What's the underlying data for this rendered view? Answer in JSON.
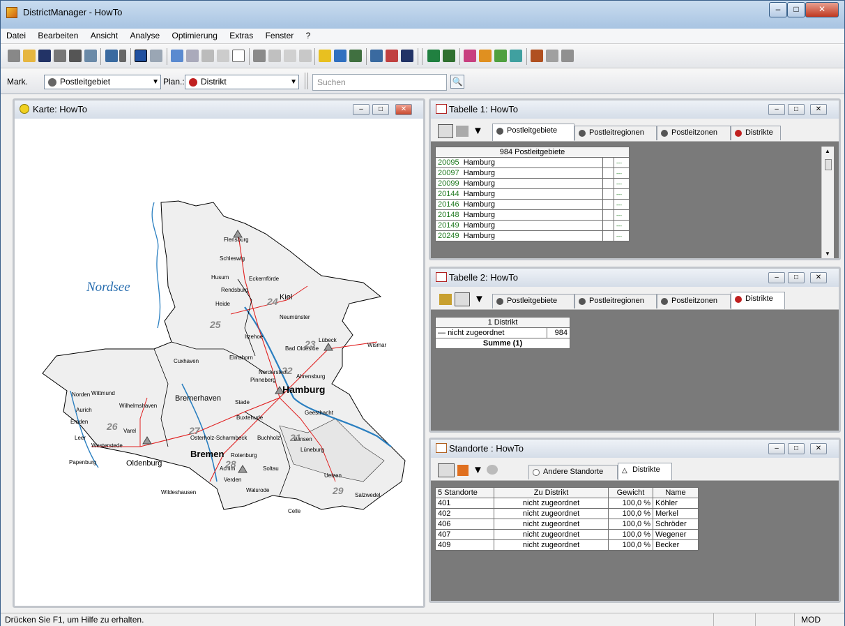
{
  "window": {
    "title": "DistrictManager - HowTo"
  },
  "menu": [
    "Datei",
    "Bearbeiten",
    "Ansicht",
    "Analyse",
    "Optimierung",
    "Extras",
    "Fenster",
    "?"
  ],
  "toolbar2": {
    "mark_label": "Mark.",
    "mark_value": "Postleitgebiet",
    "plan_label": "Plan.:",
    "plan_value": "Distrikt",
    "search_placeholder": "Suchen"
  },
  "map_window": {
    "title": "Karte: HowTo",
    "sea_label": "Nordsee",
    "cities": [
      {
        "name": "Flensburg"
      },
      {
        "name": "Schleswig"
      },
      {
        "name": "Husum"
      },
      {
        "name": "Eckernförde"
      },
      {
        "name": "Rendsburg"
      },
      {
        "name": "Kiel"
      },
      {
        "name": "Heide"
      },
      {
        "name": "Neumünster"
      },
      {
        "name": "Itzehoe"
      },
      {
        "name": "Lübeck"
      },
      {
        "name": "Bad Oldesloe"
      },
      {
        "name": "Wismar"
      },
      {
        "name": "Cuxhaven"
      },
      {
        "name": "Elmshorn"
      },
      {
        "name": "Norderstedt"
      },
      {
        "name": "Pinneberg"
      },
      {
        "name": "Ahrensburg"
      },
      {
        "name": "Hamburg"
      },
      {
        "name": "Stade"
      },
      {
        "name": "Bremerhaven"
      },
      {
        "name": "Buxtehude"
      },
      {
        "name": "Geesthacht"
      },
      {
        "name": "Norden"
      },
      {
        "name": "Wittmund"
      },
      {
        "name": "Aurich"
      },
      {
        "name": "Emden"
      },
      {
        "name": "Wilhelmshaven"
      },
      {
        "name": "Leer"
      },
      {
        "name": "Westerstede"
      },
      {
        "name": "Varel"
      },
      {
        "name": "Papenburg"
      },
      {
        "name": "Oldenburg"
      },
      {
        "name": "Osterholz-Scharmbeck"
      },
      {
        "name": "Buchholz"
      },
      {
        "name": "Winsen"
      },
      {
        "name": "Lüneburg"
      },
      {
        "name": "Bremen"
      },
      {
        "name": "Rotenburg"
      },
      {
        "name": "Achim"
      },
      {
        "name": "Verden"
      },
      {
        "name": "Soltau"
      },
      {
        "name": "Uelzen"
      },
      {
        "name": "Walsrode"
      },
      {
        "name": "Salzwedel"
      },
      {
        "name": "Celle"
      },
      {
        "name": "Wildeshausen"
      }
    ],
    "district_numbers": [
      "24",
      "25",
      "22",
      "23",
      "26",
      "27",
      "28",
      "21",
      "29"
    ]
  },
  "table1": {
    "title": "Tabelle 1: HowTo",
    "tabs": [
      "Postleitgebiete",
      "Postleitregionen",
      "Postleitzonen",
      "Distrikte"
    ],
    "active_tab": 0,
    "header": "984 Postleitgebiete",
    "rows": [
      {
        "code": "20095",
        "city": "Hamburg",
        "val": "---"
      },
      {
        "code": "20097",
        "city": "Hamburg",
        "val": "---"
      },
      {
        "code": "20099",
        "city": "Hamburg",
        "val": "---"
      },
      {
        "code": "20144",
        "city": "Hamburg",
        "val": "---"
      },
      {
        "code": "20146",
        "city": "Hamburg",
        "val": "---"
      },
      {
        "code": "20148",
        "city": "Hamburg",
        "val": "---"
      },
      {
        "code": "20149",
        "city": "Hamburg",
        "val": "---"
      },
      {
        "code": "20249",
        "city": "Hamburg",
        "val": "---"
      }
    ]
  },
  "table2": {
    "title": "Tabelle 2: HowTo",
    "tabs": [
      "Postleitgebiete",
      "Postleitregionen",
      "Postleitzonen",
      "Distrikte"
    ],
    "active_tab": 3,
    "header": "1 Distrikt",
    "row": {
      "name": "nicht zugeordnet",
      "count": "984"
    },
    "summary": "Summe (1)"
  },
  "standorte": {
    "title": "Standorte : HowTo",
    "tabs": [
      "Andere Standorte",
      "Distrikte"
    ],
    "active_tab": 1,
    "headers": [
      "5 Standorte",
      "Zu Distrikt",
      "Gewicht",
      "Name"
    ],
    "rows": [
      {
        "id": "401",
        "district": "nicht zugeordnet",
        "weight": "100,0 %",
        "name": "Köhler"
      },
      {
        "id": "402",
        "district": "nicht zugeordnet",
        "weight": "100,0 %",
        "name": "Merkel"
      },
      {
        "id": "406",
        "district": "nicht zugeordnet",
        "weight": "100,0 %",
        "name": "Schröder"
      },
      {
        "id": "407",
        "district": "nicht zugeordnet",
        "weight": "100,0 %",
        "name": "Wegener"
      },
      {
        "id": "409",
        "district": "nicht zugeordnet",
        "weight": "100,0 %",
        "name": "Becker"
      }
    ]
  },
  "status": {
    "help": "Drücken Sie F1, um Hilfe zu erhalten.",
    "mode": "MOD"
  }
}
